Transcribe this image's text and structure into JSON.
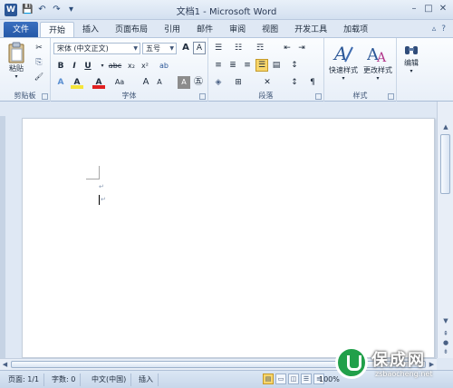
{
  "titlebar": {
    "app_icon": "W",
    "title": "文档1 - Microsoft Word",
    "qat": [
      "save-icon",
      "undo-icon",
      "redo-icon",
      "customize-icon"
    ],
    "qat_glyphs": [
      "💾",
      "↶",
      "↷",
      "▾"
    ],
    "window_controls": [
      "–",
      "□",
      "✕"
    ]
  },
  "tabs": {
    "file": "文件",
    "items": [
      "开始",
      "插入",
      "页面布局",
      "引用",
      "邮件",
      "审阅",
      "视图",
      "开发工具",
      "加载项"
    ],
    "right_icons": [
      "▵",
      "?"
    ]
  },
  "ribbon": {
    "clipboard": {
      "label": "剪贴板",
      "paste": "粘贴",
      "cut": "✂",
      "copy": "⎘",
      "format_painter": "🖌"
    },
    "font": {
      "label": "字体",
      "font_name": "宋体 (中文正文)",
      "font_size": "五号",
      "grow": "A",
      "shrink": "A",
      "row2": [
        "B",
        "I",
        "U",
        "abc",
        "x₂",
        "x²",
        "Aa"
      ],
      "row3": [
        "A",
        "A",
        "A",
        "Aa",
        "A",
        "A",
        "A",
        "㊄"
      ]
    },
    "paragraph": {
      "label": "段落",
      "row1": [
        "☰",
        "☷",
        "☶",
        "⇤",
        "⇥"
      ],
      "row2": [
        "≡",
        "≣",
        "≡",
        "☰",
        "▤",
        "↕"
      ],
      "row3": [
        "◈",
        "⊞",
        "✕",
        "↕",
        "¶"
      ]
    },
    "styles": {
      "label": "样式",
      "quick_styles": "快速样式",
      "change_styles": "更改样式"
    },
    "editing": {
      "label": "编辑",
      "find": "编辑"
    }
  },
  "statusbar": {
    "page": "页面: 1/1",
    "words": "字数: 0",
    "language": "中文(中国)",
    "mode": "插入",
    "zoom": "100%",
    "zoom_minus": "−",
    "zoom_plus": "+"
  },
  "document": {
    "para_mark": "↵"
  },
  "watermark": {
    "title": "保成网",
    "url": "zsbaocheng.net"
  },
  "colors": {
    "file_tab": "#2b5797",
    "selected_button": "#f8d66b",
    "watermark_logo": "#21a04a"
  }
}
